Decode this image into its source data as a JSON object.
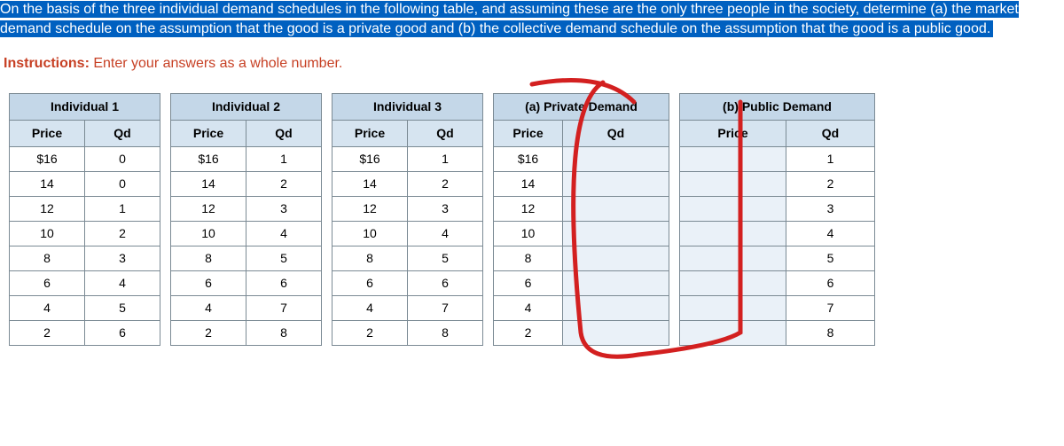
{
  "prompt_highlighted": "On the basis of the three individual demand schedules in the following table, and assuming these are the only three people in the society, determine (a) the market demand schedule on the assumption that the good is a private good and (b) the collective demand schedule on the assumption that the good is a public good.",
  "instructions_label": "Instructions:",
  "instructions_text": " Enter your answers as a whole number.",
  "headers": {
    "ind1": "Individual 1",
    "ind2": "Individual 2",
    "ind3": "Individual 3",
    "priv": "(a) Private Demand",
    "pub": "(b) Public Demand",
    "price": "Price",
    "qd": "Qd"
  },
  "rows": [
    {
      "p1": "$16",
      "q1": "0",
      "p2": "$16",
      "q2": "1",
      "p3": "$16",
      "q3": "1",
      "pa": "$16",
      "qa": "",
      "pb": "",
      "qb": "1"
    },
    {
      "p1": "14",
      "q1": "0",
      "p2": "14",
      "q2": "2",
      "p3": "14",
      "q3": "2",
      "pa": "14",
      "qa": "",
      "pb": "",
      "qb": "2"
    },
    {
      "p1": "12",
      "q1": "1",
      "p2": "12",
      "q2": "3",
      "p3": "12",
      "q3": "3",
      "pa": "12",
      "qa": "",
      "pb": "",
      "qb": "3"
    },
    {
      "p1": "10",
      "q1": "2",
      "p2": "10",
      "q2": "4",
      "p3": "10",
      "q3": "4",
      "pa": "10",
      "qa": "",
      "pb": "",
      "qb": "4"
    },
    {
      "p1": "8",
      "q1": "3",
      "p2": "8",
      "q2": "5",
      "p3": "8",
      "q3": "5",
      "pa": "8",
      "qa": "",
      "pb": "",
      "qb": "5"
    },
    {
      "p1": "6",
      "q1": "4",
      "p2": "6",
      "q2": "6",
      "p3": "6",
      "q3": "6",
      "pa": "6",
      "qa": "",
      "pb": "",
      "qb": "6"
    },
    {
      "p1": "4",
      "q1": "5",
      "p2": "4",
      "q2": "7",
      "p3": "4",
      "q3": "7",
      "pa": "4",
      "qa": "",
      "pb": "",
      "qb": "7"
    },
    {
      "p1": "2",
      "q1": "6",
      "p2": "2",
      "q2": "8",
      "p3": "2",
      "q3": "8",
      "pa": "2",
      "qa": "",
      "pb": "",
      "qb": "8"
    }
  ]
}
